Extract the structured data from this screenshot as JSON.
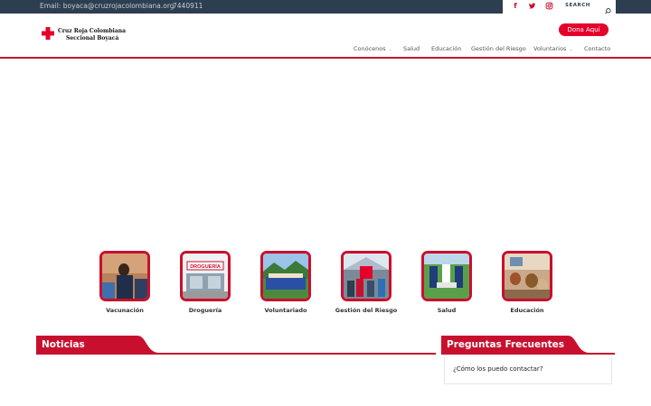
{
  "topbar": {
    "email": "Email: boyaca@cruzrojacolombiana.org",
    "phone": "7440911",
    "search_placeholder": "SEARCH",
    "social": [
      "facebook-icon",
      "twitter-icon",
      "instagram-icon"
    ]
  },
  "header": {
    "logo_line1": "Cruz Roja Colombiana",
    "logo_line2": "Seccional Boyacá",
    "donate_label": "Dona Aquí",
    "nav": [
      {
        "label": "Conócenos",
        "has_dropdown": true
      },
      {
        "label": "Salud",
        "has_dropdown": false
      },
      {
        "label": "Educación",
        "has_dropdown": false
      },
      {
        "label": "Gestión del Riesgo",
        "has_dropdown": false
      },
      {
        "label": "Voluntarios",
        "has_dropdown": true
      },
      {
        "label": "Contacto",
        "has_dropdown": false
      }
    ]
  },
  "services": [
    {
      "label": "Vacunación"
    },
    {
      "label": "Droguería",
      "sign": "DROGUERÍA"
    },
    {
      "label": "Voluntariado"
    },
    {
      "label": "Gestión del Riesgo"
    },
    {
      "label": "Salud"
    },
    {
      "label": "Educación"
    }
  ],
  "sections": {
    "news_title": "Noticias",
    "faq_title": "Preguntas Frecuentes",
    "faq_items": [
      "¿Cómo los puedo contactar?"
    ]
  },
  "colors": {
    "brand_red": "#c8102e",
    "topbar_bg": "#2c3e50",
    "donate_red": "#e4002b"
  }
}
